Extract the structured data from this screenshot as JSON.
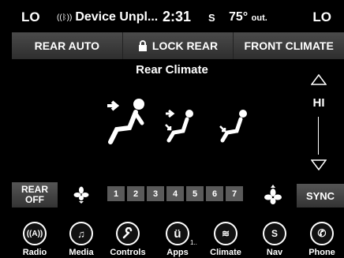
{
  "status": {
    "left_temp": "LO",
    "right_temp": "LO",
    "device": "Device Unpl...",
    "time": "2:31",
    "seat_indicator": "S",
    "outside_temp": "75°",
    "outside_label": "out."
  },
  "top_buttons": {
    "rear_auto": "REAR AUTO",
    "lock_rear": "LOCK REAR",
    "front_climate": "FRONT CLIMATE"
  },
  "title": "Rear Climate",
  "fan": {
    "level_label": "HI"
  },
  "controls": {
    "rear_off": [
      "REAR",
      "OFF"
    ],
    "speeds": [
      "1",
      "2",
      "3",
      "4",
      "5",
      "6",
      "7"
    ],
    "sync": "SYNC"
  },
  "nav": {
    "radio": "Radio",
    "media": "Media",
    "controls": "Controls",
    "apps": "Apps",
    "apps_badge": "1..",
    "climate": "Climate",
    "nav": "Nav",
    "phone": "Phone"
  },
  "icons": [
    "bluetooth-icon",
    "lock-icon",
    "mode-panel-icon",
    "mode-bilevel-icon",
    "mode-floor-icon",
    "fan-icon",
    "radio-icon",
    "music-icon",
    "wrench-icon",
    "uconnect-icon",
    "climate-icon",
    "compass-icon",
    "phone-icon"
  ]
}
